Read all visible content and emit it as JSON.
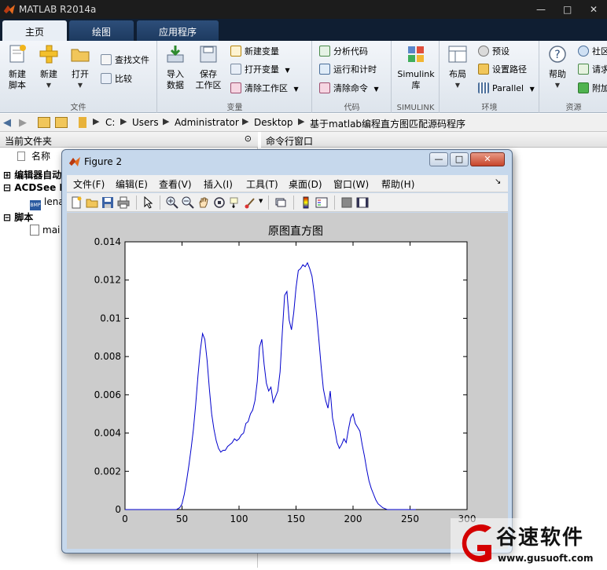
{
  "window": {
    "title": "MATLAB R2014a",
    "controls": [
      "—",
      "□",
      "✕"
    ]
  },
  "tabs": [
    {
      "label": "主页",
      "active": true
    },
    {
      "label": "绘图",
      "active": false
    },
    {
      "label": "应用程序",
      "active": false
    }
  ],
  "ribbon": {
    "file_group": {
      "label": "文件",
      "new_script": "新建\n脚本",
      "new": "新建",
      "open": "打开",
      "find_files": "查找文件",
      "compare": "比较"
    },
    "variable_group": {
      "label": "变量",
      "import_data": "导入\n数据",
      "save_workspace": "保存\n工作区",
      "new_variable": "新建变量",
      "open_variable": "打开变量",
      "clear_workspace": "清除工作区"
    },
    "code_group": {
      "label": "代码",
      "analyze_code": "分析代码",
      "run_and_time": "运行和计时",
      "clear_commands": "清除命令"
    },
    "simulink_group": {
      "label": "SIMULINK",
      "library": "Simulink\n库"
    },
    "environment_group": {
      "label": "环境",
      "layout": "布局",
      "preferences": "预设",
      "set_path": "设置路径",
      "parallel": "Parallel"
    },
    "resources_group": {
      "label": "资源",
      "help": "帮助",
      "community": "社区",
      "request_support": "请求",
      "addons": "附加"
    }
  },
  "address": {
    "crumbs": [
      "C:",
      "Users",
      "Administrator",
      "Desktop",
      "基于matlab编程直方图匹配源码程序"
    ]
  },
  "current_folder": {
    "title": "当前文件夹",
    "column_name": "名称",
    "rows": [
      {
        "prefix": "⊞",
        "label": "编辑器自动"
      },
      {
        "prefix": "⊟",
        "label": "ACDSee E"
      },
      {
        "prefix": "",
        "label": "lena"
      },
      {
        "prefix": "⊟",
        "label": "脚本"
      },
      {
        "prefix": "",
        "label": "mai"
      }
    ]
  },
  "command_window": {
    "title": "命令行窗口"
  },
  "figure": {
    "title": "Figure 2",
    "menu": [
      "文件(F)",
      "编辑(E)",
      "查看(V)",
      "插入(I)",
      "工具(T)",
      "桌面(D)",
      "窗口(W)",
      "帮助(H)"
    ],
    "toolbar_icons": [
      "new-figure-icon",
      "open-file-icon",
      "save-icon",
      "print-icon",
      "edit-plot-icon",
      "zoom-in-icon",
      "zoom-out-icon",
      "pan-icon",
      "rotate-3d-icon",
      "data-cursor-icon",
      "brush-icon",
      "link-plot-icon",
      "insert-colorbar-icon",
      "insert-legend-icon",
      "hide-plot-tools-icon",
      "show-plot-tools-icon"
    ]
  },
  "chart_data": {
    "type": "line",
    "title": "原图直方图",
    "xlabel": "",
    "ylabel": "",
    "xlim": [
      0,
      300
    ],
    "ylim": [
      0,
      0.014
    ],
    "xticks": [
      0,
      50,
      100,
      150,
      200,
      250,
      300
    ],
    "yticks": [
      0,
      0.002,
      0.004,
      0.006,
      0.008,
      0.01,
      0.012,
      0.014
    ],
    "xtick_labels": [
      "0",
      "50",
      "100",
      "150",
      "200",
      "250",
      "300"
    ],
    "ytick_labels": [
      "0",
      "0.002",
      "0.004",
      "0.006",
      "0.008",
      "0.01",
      "0.012",
      "0.014"
    ],
    "grid": false,
    "line_color": "#0000cc",
    "series": [
      {
        "x": [
          0,
          10,
          20,
          30,
          40,
          45,
          48,
          50,
          52,
          54,
          56,
          58,
          60,
          62,
          64,
          66,
          68,
          70,
          72,
          74,
          76,
          78,
          80,
          82,
          84,
          86,
          88,
          90,
          92,
          94,
          96,
          98,
          100,
          102,
          104,
          106,
          108,
          110,
          112,
          114,
          116,
          118,
          120,
          122,
          124,
          126,
          128,
          130,
          132,
          134,
          136,
          138,
          140,
          142,
          144,
          146,
          148,
          150,
          152,
          154,
          156,
          158,
          160,
          162,
          164,
          166,
          168,
          170,
          172,
          174,
          176,
          178,
          180,
          182,
          184,
          186,
          188,
          190,
          192,
          194,
          196,
          198,
          200,
          202,
          204,
          206,
          208,
          210,
          212,
          214,
          216,
          218,
          220,
          222,
          224,
          226,
          228,
          230,
          235,
          240,
          250,
          255
        ],
        "y": [
          0,
          0,
          0,
          0,
          0,
          0,
          0.0001,
          0.0003,
          0.0008,
          0.0015,
          0.0023,
          0.0032,
          0.0042,
          0.0055,
          0.007,
          0.0083,
          0.0092,
          0.0089,
          0.0078,
          0.0063,
          0.005,
          0.0042,
          0.0036,
          0.0032,
          0.003,
          0.0031,
          0.0031,
          0.0033,
          0.0034,
          0.0035,
          0.0037,
          0.0036,
          0.0037,
          0.0039,
          0.004,
          0.0045,
          0.0046,
          0.005,
          0.0052,
          0.0057,
          0.0067,
          0.0085,
          0.0089,
          0.0076,
          0.0066,
          0.0062,
          0.0064,
          0.0056,
          0.0059,
          0.0062,
          0.0072,
          0.0093,
          0.0112,
          0.0114,
          0.0099,
          0.0094,
          0.0103,
          0.0116,
          0.0125,
          0.0126,
          0.0128,
          0.0127,
          0.0129,
          0.0126,
          0.0122,
          0.0113,
          0.0102,
          0.0089,
          0.0075,
          0.0063,
          0.0057,
          0.0053,
          0.0062,
          0.0048,
          0.0042,
          0.0035,
          0.0032,
          0.0034,
          0.0037,
          0.0035,
          0.0042,
          0.0048,
          0.005,
          0.0045,
          0.0043,
          0.0041,
          0.0034,
          0.0028,
          0.0021,
          0.0015,
          0.0011,
          0.0008,
          0.0005,
          0.0003,
          0.0002,
          0.0001,
          5e-05,
          0,
          0,
          0,
          0,
          0
        ]
      }
    ]
  },
  "watermark": {
    "brand_cn": "谷速软件",
    "url": "www.gusuoft.com",
    "logo_color": "#d40000"
  }
}
